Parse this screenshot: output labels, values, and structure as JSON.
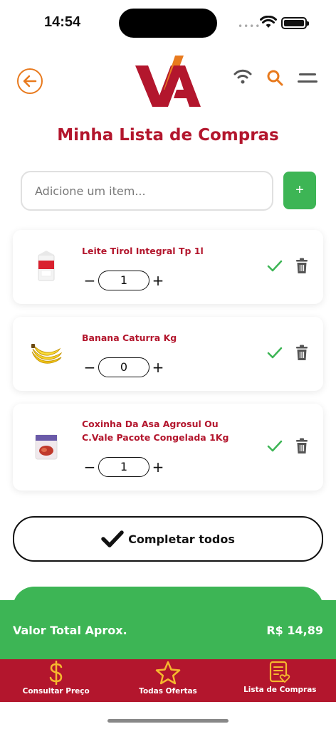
{
  "status": {
    "time": "14:54",
    "dots": "••••"
  },
  "header": {
    "logo_alt": "VA"
  },
  "page": {
    "title": "Minha Lista de Compras"
  },
  "add_item": {
    "placeholder": "Adicione um item...",
    "button_label": "+"
  },
  "items": [
    {
      "name": "Leite Tirol Integral Tp 1l",
      "quantity": "1",
      "minus": "−",
      "plus": "+"
    },
    {
      "name": "Banana Caturra Kg",
      "quantity": "0",
      "minus": "−",
      "plus": "+"
    },
    {
      "name": "Coxinha Da Asa Agrosul Ou C.Vale Pacote Congelada 1Kg",
      "quantity": "1",
      "minus": "−",
      "plus": "+"
    }
  ],
  "actions": {
    "complete_all": "Completar todos"
  },
  "total": {
    "label": "Valor Total Aprox.",
    "value": "R$ 14,89"
  },
  "nav": [
    {
      "label": "Consultar Preço",
      "icon": "dollar-icon"
    },
    {
      "label": "Todas Ofertas",
      "icon": "star-icon"
    },
    {
      "label": "Lista de Compras",
      "icon": "list-heart-icon"
    }
  ],
  "colors": {
    "brand_red": "#b3162d",
    "brand_orange": "#e87a1e",
    "green": "#3db555",
    "nav_icon": "#f5b82e"
  }
}
